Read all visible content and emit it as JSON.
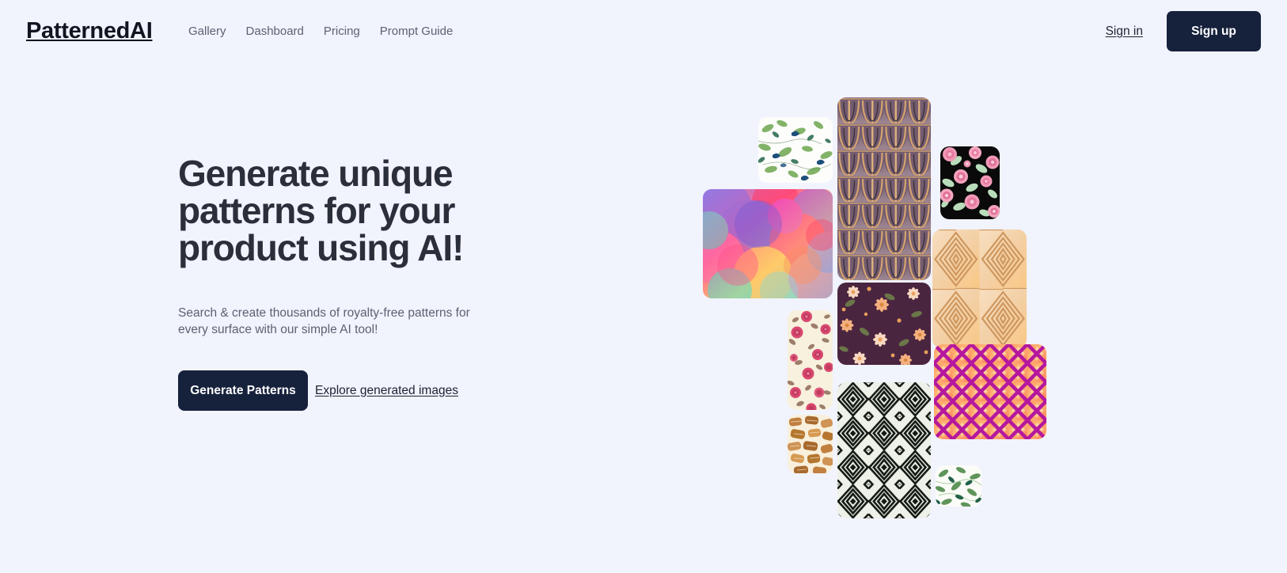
{
  "theme": {
    "page_background": "#f1f3fd",
    "ink": "#2b2f3a",
    "muted": "#5c6270",
    "button_dark": "#16213c",
    "button_text": "#ffffff"
  },
  "header": {
    "brand": "PatternedAI",
    "nav": [
      {
        "label": "Gallery",
        "name": "gallery"
      },
      {
        "label": "Dashboard",
        "name": "dashboard"
      },
      {
        "label": "Pricing",
        "name": "pricing"
      },
      {
        "label": "Prompt Guide",
        "name": "prompt-guide"
      }
    ],
    "sign_in": "Sign in",
    "sign_up": "Sign up"
  },
  "hero": {
    "title": "Generate unique\npatterns for your\nproduct using AI!",
    "subtitle": "Search & create thousands of royalty-free patterns for every surface with our simple AI tool!",
    "primary_cta": "Generate Patterns",
    "secondary_cta": "Explore generated images"
  },
  "collage": {
    "tiles": [
      {
        "name": "pattern-tile-watercolor-leaves-blue",
        "alt": "Watercolor green leaves with blue birds on white",
        "colors": [
          "#ffffff",
          "#6ea64f",
          "#2f6f55",
          "#1d4f7a"
        ]
      },
      {
        "name": "pattern-tile-art-deco-fans",
        "alt": "Art deco fan arches in mauve and tan",
        "colors": [
          "#7c6477",
          "#d9a468",
          "#3a2d38",
          "#b09aa6"
        ]
      },
      {
        "name": "pattern-tile-pink-roses-black",
        "alt": "Pink roses on black background",
        "colors": [
          "#0b0b0b",
          "#f09ab7",
          "#b9ddbb"
        ]
      },
      {
        "name": "pattern-tile-abstract-gradient-circles",
        "alt": "Overlapping translucent circles in rainbow gradient",
        "colors": [
          "#8a6ce0",
          "#ff3b6b",
          "#ffd36a",
          "#53d6d0",
          "#e84ad0"
        ]
      },
      {
        "name": "pattern-tile-geometric-tan-diamonds",
        "alt": "Concentric tan line diamonds",
        "colors": [
          "#f5e0c8",
          "#c99a68",
          "#f7c98a"
        ]
      },
      {
        "name": "pattern-tile-dark-floral",
        "alt": "Peach daisies on deep plum",
        "colors": [
          "#4a2540",
          "#f4b07e",
          "#f7d7c0",
          "#6f7f4a"
        ]
      },
      {
        "name": "pattern-tile-roses-cream",
        "alt": "Pink roses and brown leaves on cream",
        "colors": [
          "#f6f0dd",
          "#d9486f",
          "#8d6a56"
        ]
      },
      {
        "name": "pattern-tile-magenta-lattice",
        "alt": "Magenta lattice over peach diamonds",
        "colors": [
          "#b5179e",
          "#ff8b5e",
          "#ffd199"
        ]
      },
      {
        "name": "pattern-tile-bread-rolls",
        "alt": "Baked bread rolls on cream",
        "colors": [
          "#f7efdc",
          "#b5762f",
          "#d79a52"
        ]
      },
      {
        "name": "pattern-tile-black-white-diamonds",
        "alt": "Black and white concentric diamond ikat",
        "colors": [
          "#141a14",
          "#eef1e7"
        ]
      },
      {
        "name": "pattern-tile-green-leaf-small",
        "alt": "Watercolor green leaves on white",
        "colors": [
          "#ffffff",
          "#4e8a4a",
          "#23604a"
        ]
      }
    ]
  }
}
